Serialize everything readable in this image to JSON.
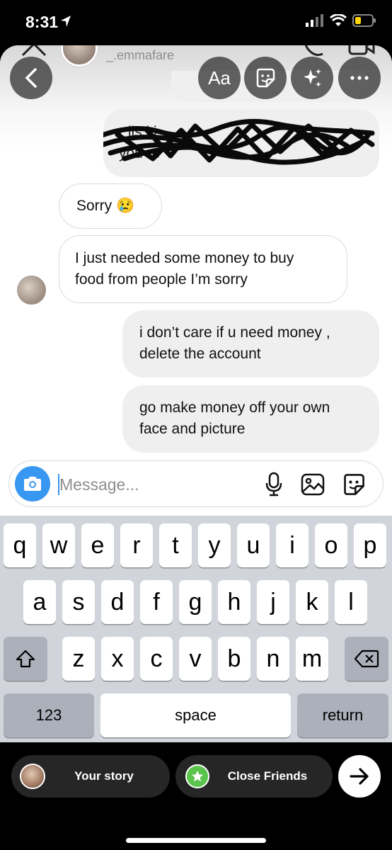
{
  "status_bar": {
    "time": "8:31"
  },
  "header": {
    "username": "_.emmafare"
  },
  "toolbar": {
    "text_tool_label": "Aa"
  },
  "conversation": {
    "redacted_message": "r  lis           ki\nyou      re",
    "messages": [
      {
        "text": "Sorry 😢",
        "direction": "incoming"
      },
      {
        "text": "I just needed some money to buy\nfood from people I’m sorry",
        "direction": "incoming"
      },
      {
        "text": "i don’t care if u need money ,\ndelete the account",
        "direction": "outgoing"
      },
      {
        "text": "go make money off your own\nface and picture",
        "direction": "outgoing"
      }
    ]
  },
  "composer": {
    "placeholder": "Message..."
  },
  "keyboard": {
    "row1": [
      "q",
      "w",
      "e",
      "r",
      "t",
      "y",
      "u",
      "i",
      "o",
      "p"
    ],
    "row2": [
      "a",
      "s",
      "d",
      "f",
      "g",
      "h",
      "j",
      "k",
      "l"
    ],
    "row3": [
      "z",
      "x",
      "c",
      "v",
      "b",
      "n",
      "m"
    ],
    "numbers_label": "123",
    "space_label": "space",
    "return_label": "return"
  },
  "share_bar": {
    "your_story_label": "Your story",
    "close_friends_label": "Close Friends"
  },
  "colors": {
    "accent": "#3897f0",
    "close_friends_green": "#5ac44c",
    "bubble_out": "#efefef"
  }
}
